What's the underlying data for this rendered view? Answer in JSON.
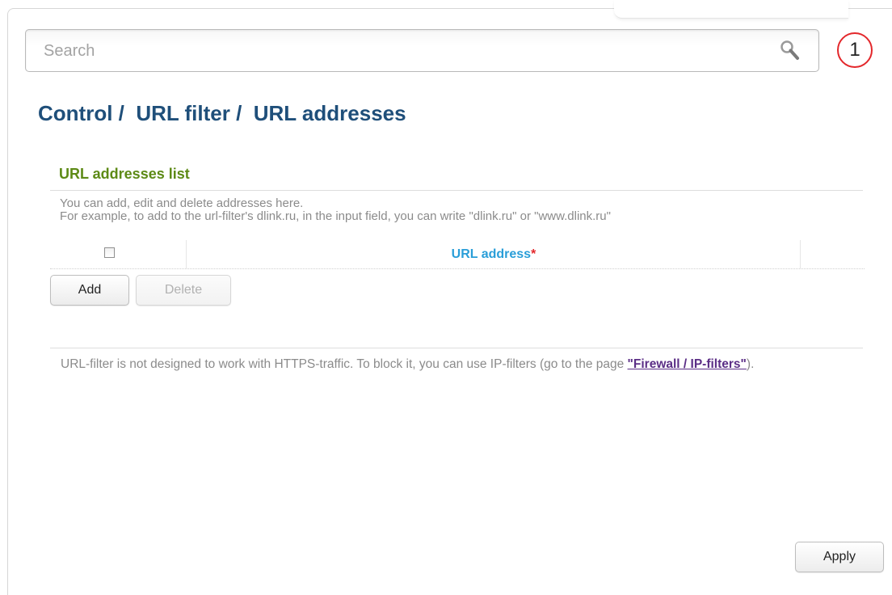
{
  "search": {
    "placeholder": "Search"
  },
  "notifications": {
    "count": "1"
  },
  "breadcrumb": {
    "text": "Control /  URL filter /  URL addresses"
  },
  "section": {
    "title": "URL addresses list",
    "desc_line1": "You can add, edit and delete addresses here.",
    "desc_line2": "For example, to add to the url-filter's dlink.ru, in the input field, you can write \"dlink.ru\" or \"www.dlink.ru\""
  },
  "table": {
    "column_url": "URL address",
    "required_mark": "*"
  },
  "buttons": {
    "add": "Add",
    "delete": "Delete",
    "apply": "Apply"
  },
  "note": {
    "text": "URL-filter is not designed to work with HTTPS-traffic. To block it, you can use IP-filters (go to the page ",
    "link": "\"Firewall / IP-filters\"",
    "suffix": ")."
  },
  "colors": {
    "accent_red": "#e3272b",
    "title_blue": "#1f4f7a",
    "section_green": "#5d8a16",
    "column_blue": "#2a9ed8"
  }
}
